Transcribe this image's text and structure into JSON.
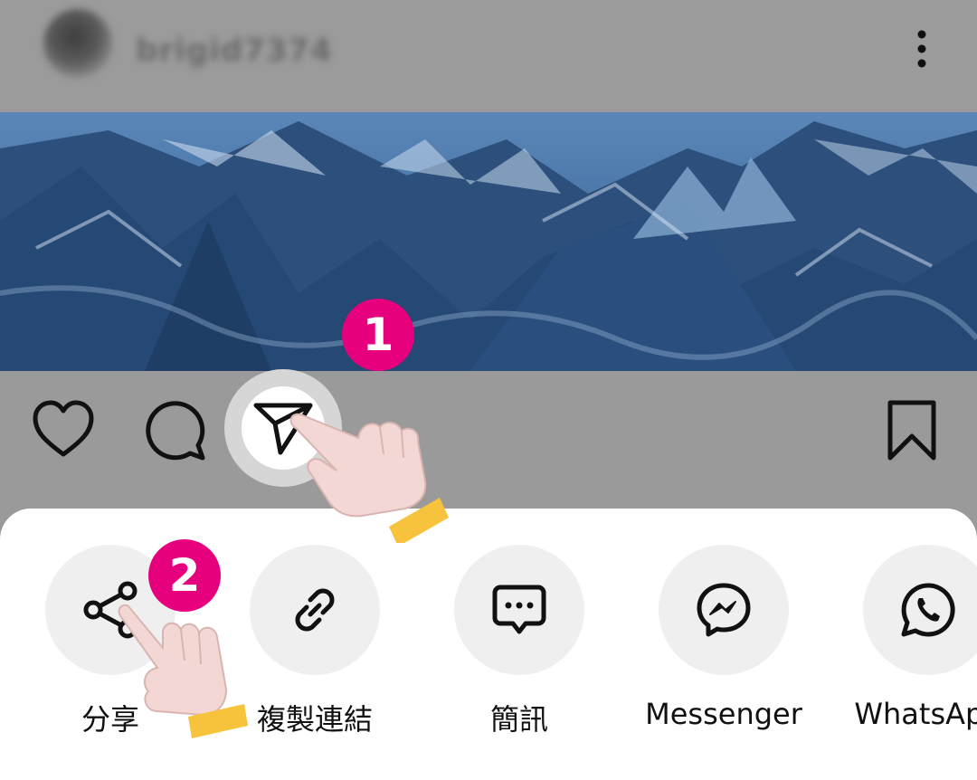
{
  "header": {
    "username": "brigid7374",
    "more_icon": "more-vertical-icon"
  },
  "post": {
    "image_alt": "snowy mountain landscape"
  },
  "actions": {
    "like_icon": "heart-icon",
    "comment_icon": "comment-icon",
    "share_icon": "send-icon",
    "save_icon": "bookmark-icon"
  },
  "share_sheet": {
    "options": [
      {
        "label": "分享",
        "icon": "share-icon"
      },
      {
        "label": "複製連結",
        "icon": "link-icon"
      },
      {
        "label": "簡訊",
        "icon": "sms-icon"
      },
      {
        "label": "Messenger",
        "icon": "messenger-icon"
      },
      {
        "label": "WhatsApp",
        "icon": "whatsapp-icon"
      }
    ]
  },
  "annotations": {
    "step_1": "1",
    "step_2": "2"
  },
  "colors": {
    "badge": "#e6007e",
    "dim_overlay": "#9a9a9a",
    "sheet_bg": "#ffffff",
    "option_circle": "#efefef",
    "cuff": "#f8c33c",
    "hand_skin": "#f3d7d4"
  }
}
